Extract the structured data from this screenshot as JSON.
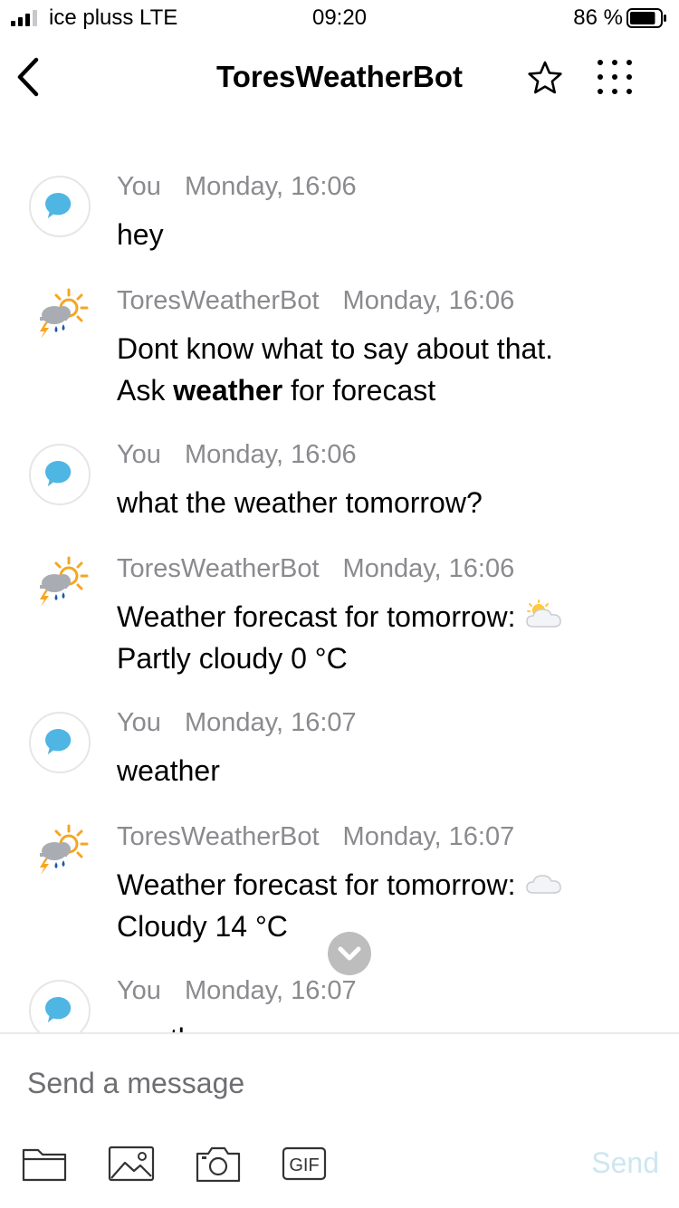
{
  "status_bar": {
    "carrier": "ice pluss LTE",
    "time": "09:20",
    "battery_percent": "86 %",
    "battery_level": 0.86,
    "signal_bars": 3
  },
  "header": {
    "title": "ToresWeatherBot",
    "back_icon": "chevron-left-icon",
    "favorite_icon": "star-icon",
    "more_icon": "dots-grid-icon"
  },
  "messages": [
    {
      "sender": "You",
      "time": "Monday, 16:06",
      "lines": [
        "hey"
      ]
    },
    {
      "sender": "ToresWeatherBot",
      "time": "Monday, 16:06",
      "line1": "Dont know what to say about that.",
      "line2_pre": "Ask ",
      "line2_bold": "weather",
      "line2_post": " for forecast"
    },
    {
      "sender": "You",
      "time": "Monday, 16:06",
      "lines": [
        "what the weather tomorrow?"
      ]
    },
    {
      "sender": "ToresWeatherBot",
      "time": "Monday, 16:06",
      "lines": [
        "Weather forecast for tomorrow:",
        "Partly cloudy 0 °C"
      ],
      "emoji": "sun-behind-cloud-icon"
    },
    {
      "sender": "You",
      "time": "Monday, 16:07",
      "lines": [
        "weather"
      ]
    },
    {
      "sender": "ToresWeatherBot",
      "time": "Monday, 16:07",
      "lines": [
        "Weather forecast for tomorrow:",
        "Cloudy 14 °C"
      ],
      "emoji": "cloud-icon"
    },
    {
      "sender": "You",
      "time": "Monday, 16:07",
      "lines": [
        "weather"
      ]
    }
  ],
  "composer": {
    "placeholder": "Send a message",
    "send_label": "Send",
    "tools": [
      "folder-icon",
      "image-icon",
      "camera-icon",
      "gif-icon"
    ],
    "gif_label": "GIF"
  },
  "colors": {
    "user_bubble": "#4fb5e3",
    "bot_sun": "#f5a623",
    "bot_cloud": "#a9adb3",
    "meta_text": "#8a8a8f",
    "send_disabled": "#cde6f2"
  }
}
